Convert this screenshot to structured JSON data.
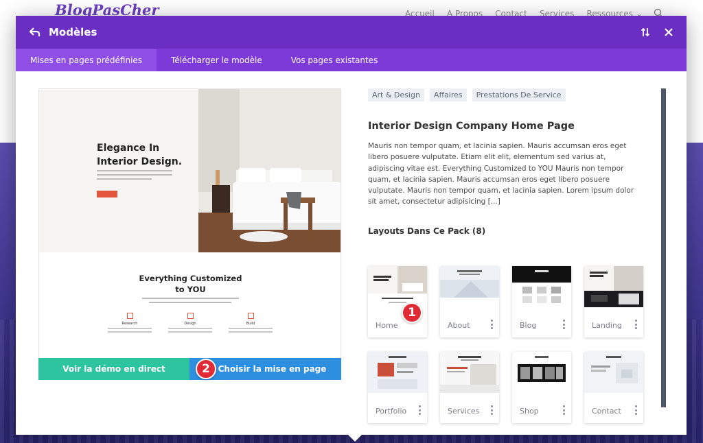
{
  "background_site": {
    "logo": "BlogPasCher",
    "nav": [
      "Accueil",
      "A Propos",
      "Contact",
      "Services",
      "Ressources"
    ]
  },
  "modal": {
    "title": "Modèles",
    "tabs": [
      {
        "label": "Mises en pages prédéfinies",
        "active": true
      },
      {
        "label": "Télécharger le modèle",
        "active": false
      },
      {
        "label": "Vos pages existantes",
        "active": false
      }
    ]
  },
  "preview": {
    "hero_title": "Elegance In Interior Design.",
    "section_title": "Everything Customized to YOU",
    "columns": [
      "Research",
      "Design",
      "Build"
    ],
    "demo_button": "Voir la démo en direct",
    "choose_button": "Choisir la mise en page",
    "badge_choose": "2"
  },
  "details": {
    "tags": [
      "Art & Design",
      "Affaires",
      "Prestations De Service"
    ],
    "title": "Interior Design Company Home Page",
    "description": "Mauris non tempor quam, et lacinia sapien. Mauris accumsan eros eget libero posuere vulputate. Etiam elit elit, elementum sed varius at, adipiscing vitae est. Everything Customized to YOU Mauris non tempor quam, et lacinia sapien. Mauris accumsan eros eget libero posuere vulputate. Mauris non tempor quam, et lacinia sapien. Lorem ipsum dolor sit amet, consectetur adipisicing [...]",
    "layouts_title": "Layouts Dans Ce Pack (8)",
    "badge_home": "1"
  },
  "layouts": [
    {
      "label": "Home"
    },
    {
      "label": "About"
    },
    {
      "label": "Blog"
    },
    {
      "label": "Landing"
    },
    {
      "label": "Portfolio"
    },
    {
      "label": "Services"
    },
    {
      "label": "Shop"
    },
    {
      "label": "Contact"
    }
  ],
  "colors": {
    "header": "#6a2fc2",
    "tabs": "#7d3ad8",
    "demo_button": "#2fc4a0",
    "choose_button": "#2e8fe0",
    "badge": "#e02b36"
  }
}
